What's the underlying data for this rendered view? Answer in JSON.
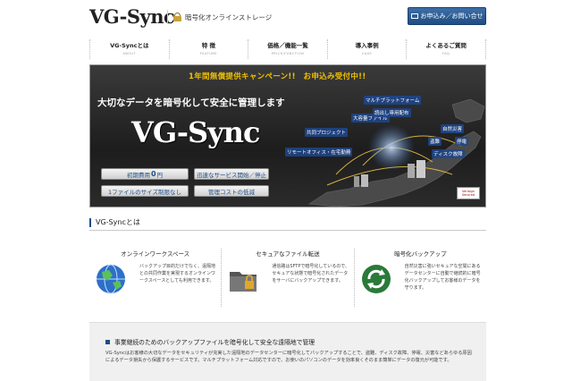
{
  "header": {
    "logo": "VG-Sync",
    "tagline": "暗号化オンラインストレージ",
    "apply_label": "お申込み／お問い合せ"
  },
  "nav": [
    {
      "label": "VG-Syncとは",
      "sub": "ABOUT"
    },
    {
      "label": "特 徴",
      "sub": "FEATURE"
    },
    {
      "label": "価格／機能一覧",
      "sub": "PRICE/FUNCTION"
    },
    {
      "label": "導入事例",
      "sub": "CASE"
    },
    {
      "label": "よくあるご質問",
      "sub": "FAQ"
    }
  ],
  "hero": {
    "campaign": "1年間無償提供キャンペーン!!　お申込み受付中!!",
    "lead": "大切なデータを暗号化して安全に管理します",
    "logo": "VG-Sync",
    "feature_buttons": {
      "initial_cost_prefix": "初期費用",
      "initial_cost_value": "0",
      "initial_cost_suffix": "円",
      "fast_service": "迅速なサービス開始／停止",
      "no_size_limit": "1ファイルのサイズ制限なし",
      "low_cost": "管理コストの低減"
    },
    "map_labels": {
      "multi_platform": "マルチプラットフォーム",
      "large_file": "大容量ファイル",
      "read_only": "読出し専用配布",
      "joint_project": "共同プロジェクト",
      "remote_office": "リモートオフィス・在宅勤務",
      "disaster": "自然災害",
      "theft": "盗難",
      "outage": "停電",
      "disk_failure": "ディスク故障"
    },
    "badge": "Verisign Secured"
  },
  "section": {
    "title": "VG-Syncとは"
  },
  "features": [
    {
      "title": "オンラインワークスペース",
      "icon": "globe-icon",
      "body": "バックアップ目的だけでなく、遠隔地との共同作業を実現するオンラインワークスペースとしても利用できます。"
    },
    {
      "title": "セキュアなファイル転送",
      "icon": "folder-lock-icon",
      "body": "通信路はSFTPで暗号化しているので、セキュアな状態で暗号化されたデータをサーバにバックアップできます。"
    },
    {
      "title": "暗号化バックアップ",
      "icon": "sync-arrows-icon",
      "body": "自然災害に強いセキュアな空間にあるデータセンターに自動で継続的に暗号化バックアップしてお客様のデータを守ります。"
    }
  ],
  "panel": {
    "heading": "事業継続のためのバックアップファイルを暗号化して安全な遠隔地で管理",
    "body": "VG-Syncはお客様の大切なデータをセキュリティが充実した遠隔地のデータセンターに暗号化してバックアップすることで、盗難、ディスク故障、停電、災害などあらゆる原因によるデータ損失から保護するサービスです。マルチプラットフォーム対応ですので、お使いのパソコンのデータを効率良くそのまま簡単にデータの復元が可能です。"
  },
  "colors": {
    "brand_blue": "#1f4d84",
    "campaign_yellow": "#f0c000"
  }
}
